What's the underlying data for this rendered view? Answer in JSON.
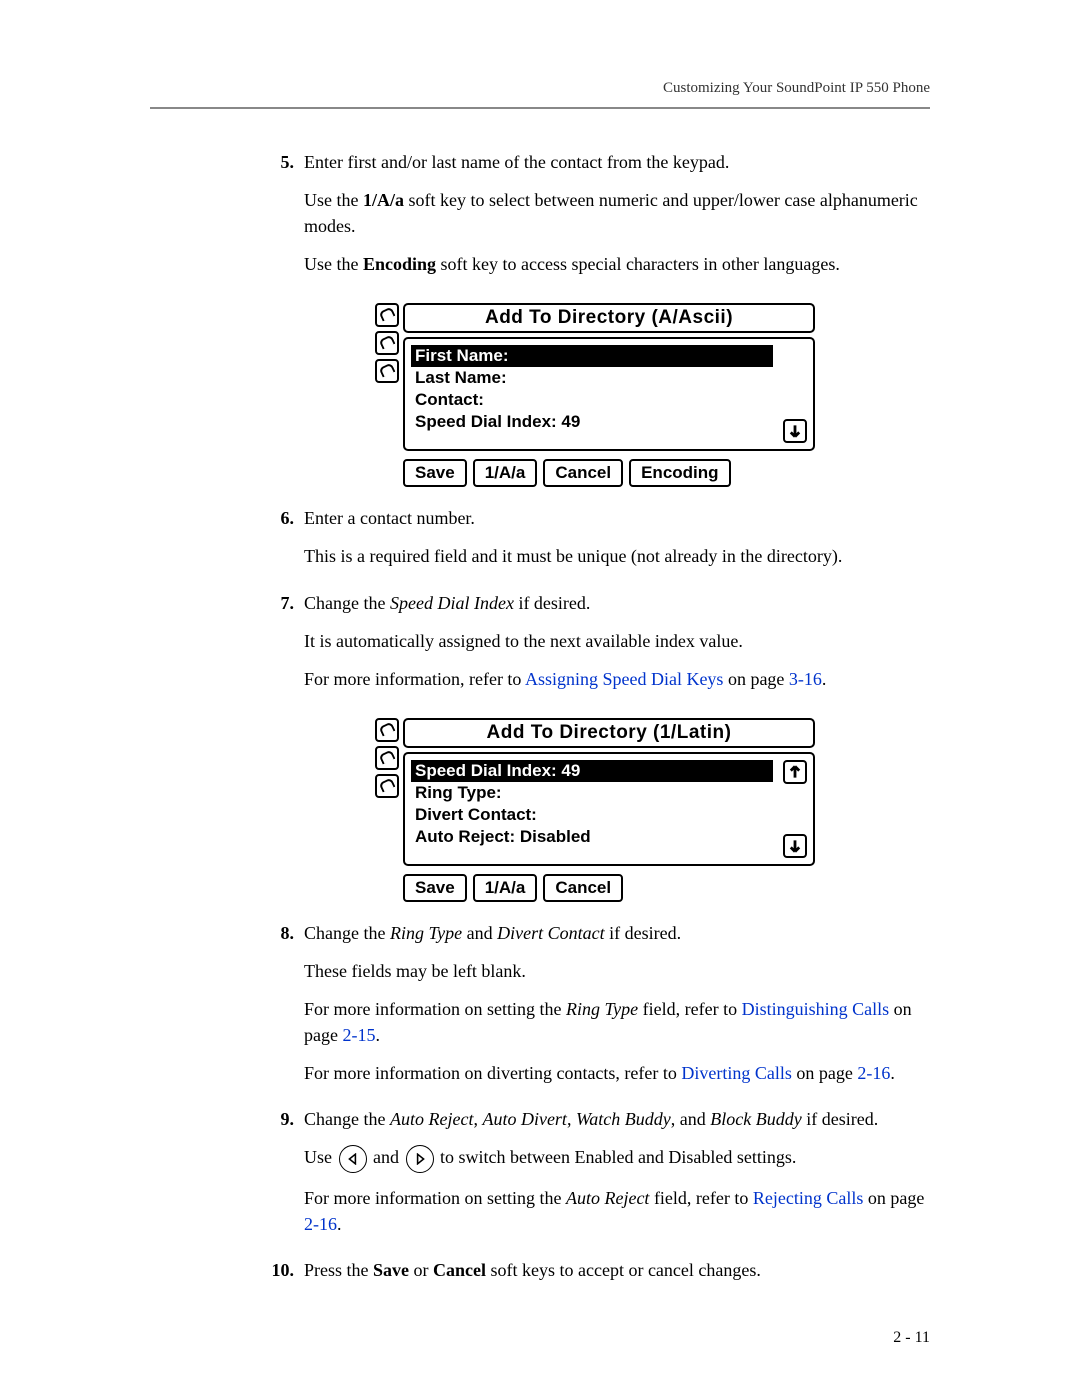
{
  "header": {
    "title": "Customizing Your SoundPoint IP 550 Phone"
  },
  "steps": {
    "s5": {
      "num": "5.",
      "p1": "Enter first and/or last name of the contact from the keypad.",
      "p2a": "Use the ",
      "p2b": "1/A/a",
      "p2c": " soft key to select between numeric and upper/lower case alphanumeric modes.",
      "p3a": "Use the ",
      "p3b": "Encoding",
      "p3c": " soft key to access special characters in other languages."
    },
    "s6": {
      "num": "6.",
      "p1": "Enter a contact number.",
      "p2": "This is a required field and it must be unique (not already in the directory)."
    },
    "s7": {
      "num": "7.",
      "p1a": "Change the ",
      "p1b": "Speed Dial Index",
      "p1c": " if desired.",
      "p2": "It is automatically assigned to the next available index value.",
      "p3a": "For more information, refer to ",
      "p3link": "Assigning Speed Dial Keys",
      "p3b": " on page ",
      "p3page": "3-16",
      "p3c": "."
    },
    "s8": {
      "num": "8.",
      "p1a": "Change the ",
      "p1b": "Ring Type",
      "p1c": " and ",
      "p1d": "Divert Contact",
      "p1e": " if desired.",
      "p2": "These fields may be left blank.",
      "p3a": "For more information on setting the ",
      "p3b": "Ring Type",
      "p3c": " field, refer to ",
      "p3link": "Distinguishing Calls",
      "p3d": " on page ",
      "p3page": "2-15",
      "p3e": ".",
      "p4a": "For more information on diverting contacts, refer to ",
      "p4link": "Diverting Calls",
      "p4b": " on page ",
      "p4page": "2-16",
      "p4c": "."
    },
    "s9": {
      "num": "9.",
      "p1a": "Change the ",
      "p1b": "Auto Reject",
      "p1c": ", ",
      "p1d": "Auto Divert",
      "p1e": ", ",
      "p1f": "Watch Buddy",
      "p1g": ", and ",
      "p1h": "Block Buddy",
      "p1i": " if desired.",
      "p2a": "Use ",
      "p2b": " and ",
      "p2c": " to switch between Enabled and Disabled settings.",
      "p3a": "For more information on setting the ",
      "p3b": "Auto Reject",
      "p3c": " field, refer to ",
      "p3link": "Rejecting Calls",
      "p3d": " on page ",
      "p3page": "2-16",
      "p3e": "."
    },
    "s10": {
      "num": "10.",
      "p1a": "Press the ",
      "p1b": "Save",
      "p1c": " or ",
      "p1d": "Cancel",
      "p1e": " soft keys to accept or cancel changes."
    }
  },
  "screen1": {
    "title": "Add To Directory (A/Ascii)",
    "rows": {
      "r1": "First Name:",
      "r2": "Last Name:",
      "r3": "Contact:",
      "r4": "Speed Dial Index: 49"
    },
    "softkeys": {
      "k1": "Save",
      "k2": "1/A/a",
      "k3": "Cancel",
      "k4": "Encoding"
    }
  },
  "screen2": {
    "title": "Add To Directory (1/Latin)",
    "rows": {
      "r1": "Speed Dial Index: 49",
      "r2": "Ring Type:",
      "r3": "Divert Contact:",
      "r4": "Auto Reject: Disabled"
    },
    "softkeys": {
      "k1": "Save",
      "k2": "1/A/a",
      "k3": "Cancel"
    }
  },
  "footer": {
    "pagenum": "2 - 11"
  }
}
